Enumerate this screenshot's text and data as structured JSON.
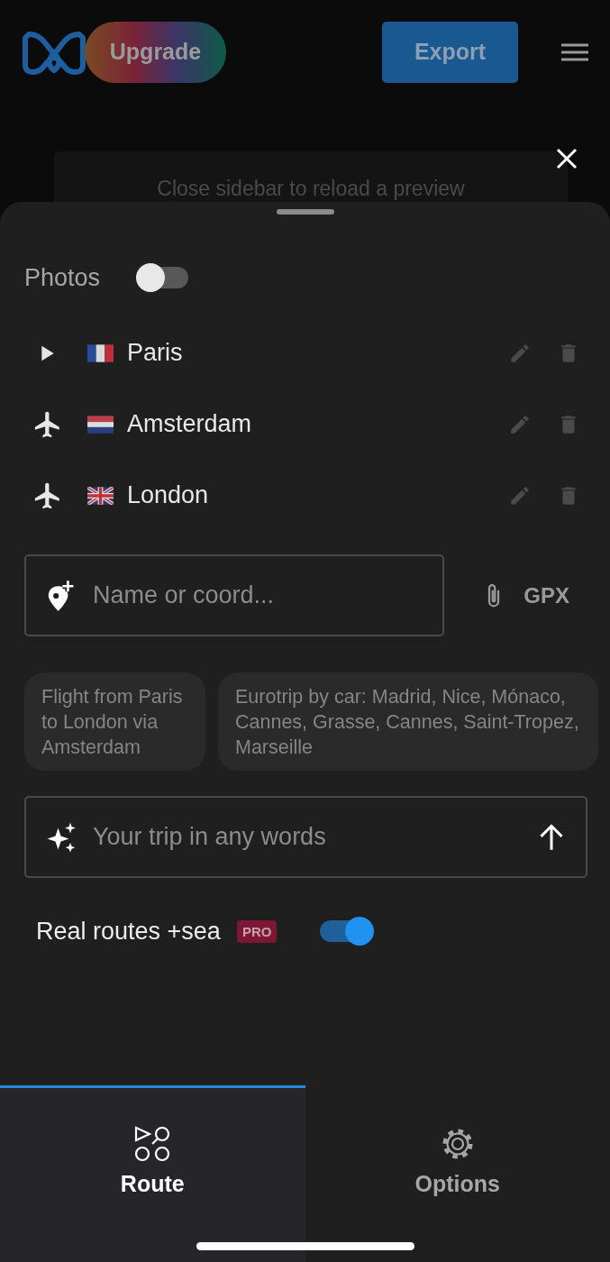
{
  "header": {
    "upgrade_button": "Upgrade",
    "export_button": "Export"
  },
  "preview_message": "Close sidebar to reload a preview",
  "photos": {
    "label": "Photos",
    "on": false
  },
  "stops": [
    {
      "name": "Paris",
      "kind": "start",
      "flag": {
        "kind": "fr"
      }
    },
    {
      "name": "Amsterdam",
      "kind": "flight",
      "flag": {
        "kind": "nl"
      }
    },
    {
      "name": "London",
      "kind": "flight",
      "flag": {
        "kind": "gb"
      }
    }
  ],
  "place_search": {
    "placeholder": "Name or coord..."
  },
  "gpx_button": "GPX",
  "suggestions": [
    "Flight from Paris to London via Amsterdam",
    "Eurotrip by car: Madrid, Nice, Mónaco, Cannes, Grasse, Cannes, Saint-Tropez, Marseille"
  ],
  "trip_prompt": {
    "placeholder": "Your trip in any words"
  },
  "real_routes": {
    "label": "Real routes +sea",
    "badge": "PRO",
    "on": true
  },
  "tabs": [
    {
      "label": "Route",
      "kind": "route",
      "selected": true
    },
    {
      "label": "Options",
      "kind": "options",
      "selected": false
    }
  ]
}
